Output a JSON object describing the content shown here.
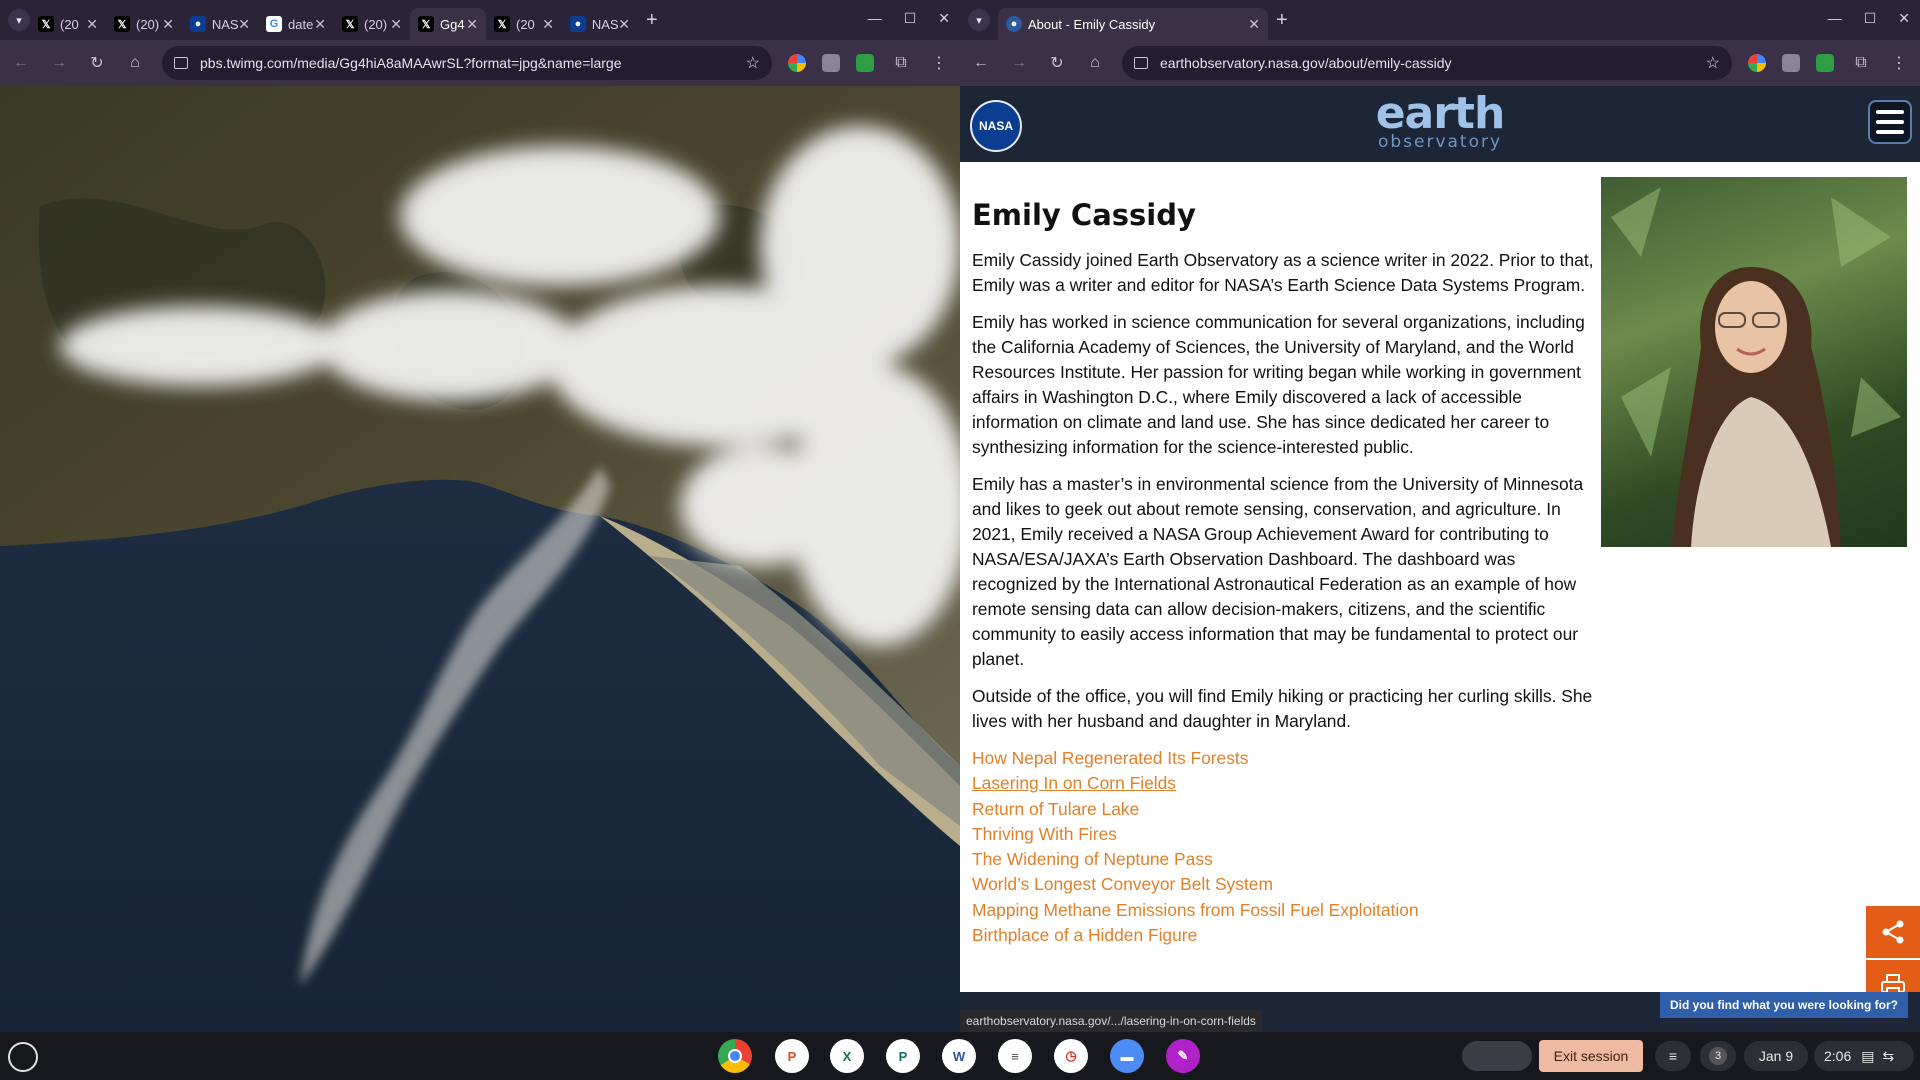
{
  "left_window": {
    "tabs": [
      {
        "title": "(20",
        "icon": "x-logo"
      },
      {
        "title": "(20)",
        "icon": "x-logo"
      },
      {
        "title": "NAS",
        "icon": "nasa-logo"
      },
      {
        "title": "date",
        "icon": "google-logo"
      },
      {
        "title": "(20)",
        "icon": "x-logo"
      },
      {
        "title": "Gg4",
        "icon": "x-logo",
        "active": true
      },
      {
        "title": "(20",
        "icon": "x-logo"
      },
      {
        "title": "NAS",
        "icon": "nasa-logo"
      }
    ],
    "url": "pbs.twimg.com/media/Gg4hiA8aMAAwrSL?format=jpg&name=large"
  },
  "right_window": {
    "tab_title": "About - Emily Cassidy",
    "url": "earthobservatory.nasa.gov/about/emily-cassidy"
  },
  "eo_header": {
    "nasa_logo_text": "NASA",
    "logo_word1": "earth",
    "logo_word2": "observatory"
  },
  "article": {
    "title": "Emily Cassidy",
    "paragraphs": [
      "Emily Cassidy joined Earth Observatory as a science writer in 2022. Prior to that, Emily was a writer and editor for NASA’s Earth Science Data Systems Program.",
      "Emily has worked in science communication for several organizations, including the California Academy of Sciences, the University of Maryland, and the World Resources Institute. Her passion for writing began while working in government affairs in Washington D.C., where Emily discovered a lack of accessible information on climate and land use. She has since dedicated her career to synthesizing information for the science-interested public.",
      "Emily has a master’s in environmental science from the University of Minnesota and likes to geek out about remote sensing, conservation, and agriculture. In 2021, Emily received a NASA Group Achievement Award for contributing to NASA/ESA/JAXA’s Earth Observation Dashboard. The dashboard was recognized by the International Astronautical Federation as an example of how remote sensing data can allow decision-makers, citizens, and the scientific community to easily access information that may be fundamental to protect our planet.",
      "Outside of the office, you will find Emily hiking or practicing her curling skills. She lives with her husband and daughter in Maryland."
    ],
    "links": [
      "How Nepal Regenerated Its Forests",
      "Lasering In on Corn Fields",
      "Return of Tulare Lake",
      "Thriving With Fires",
      "The Widening of Neptune Pass",
      "World’s Longest Conveyor Belt System",
      "Mapping Methane Emissions from Fossil Fuel Exploitation",
      "Birthplace of a Hidden Figure"
    ],
    "hovered_link_index": 1
  },
  "status_url": "earthobservatory.nasa.gov/.../lasering-in-on-corn-fields",
  "feedback_prompt": "Did you find what you were looking for?",
  "shelf": {
    "exit_label": "Exit session",
    "notification_count": "3",
    "date": "Jan 9",
    "time": "2:06"
  },
  "colors": {
    "link": "#e0812a",
    "eo_header_bg": "#1c2636",
    "share_button": "#e35d16",
    "browser_frame": "#2b2438"
  }
}
